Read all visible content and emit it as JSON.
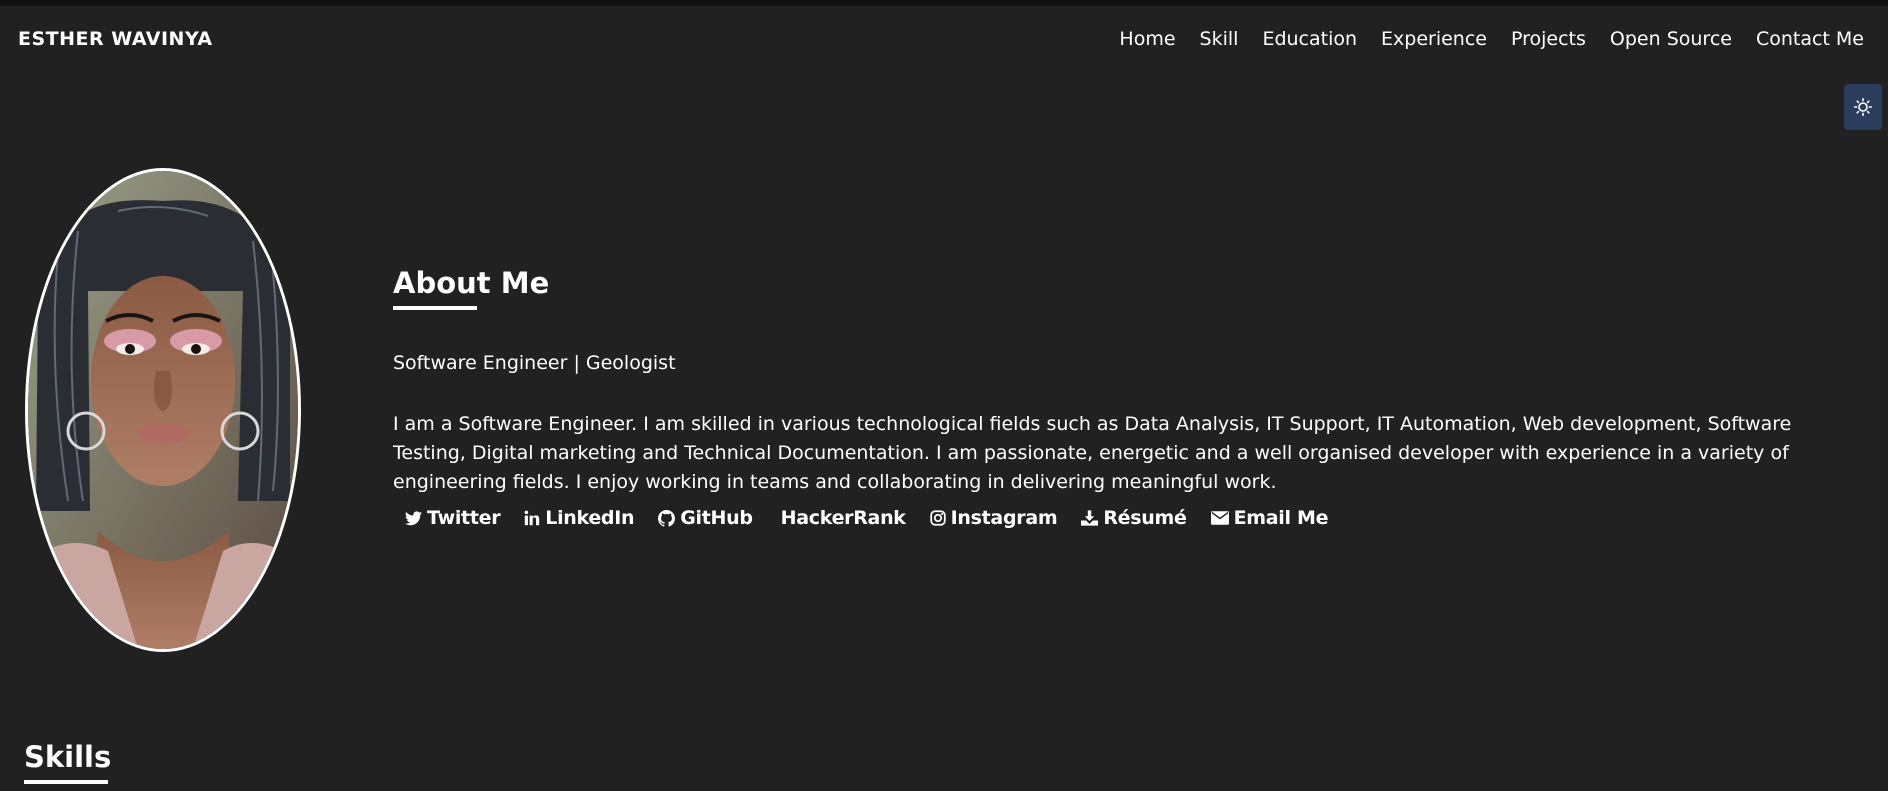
{
  "brand": "ESTHER WAVINYA",
  "nav": {
    "links": [
      "Home",
      "Skill",
      "Education",
      "Experience",
      "Projects",
      "Open Source",
      "Contact Me"
    ]
  },
  "theme_toggle": {
    "icon": "sun-icon"
  },
  "about": {
    "title": "About Me",
    "subtitle": "Software Engineer | Geologist",
    "description": "I am a Software Engineer. I am skilled in various technological fields such as Data Analysis, IT Support, IT Automation, Web development, Software Testing, Digital marketing and Technical Documentation. I am passionate, energetic and a well organised developer with experience in a variety of engineering fields. I enjoy working in teams and collaborating in delivering meaningful work.",
    "social": [
      {
        "label": "Twitter",
        "icon": "twitter-icon"
      },
      {
        "label": "LinkedIn",
        "icon": "linkedin-icon"
      },
      {
        "label": "GitHub",
        "icon": "github-icon"
      },
      {
        "label": "HackerRank",
        "icon": ""
      },
      {
        "label": "Instagram",
        "icon": "instagram-icon"
      },
      {
        "label": "Résumé",
        "icon": "download-icon"
      },
      {
        "label": "Email Me",
        "icon": "envelope-icon"
      }
    ]
  },
  "skills": {
    "title": "Skills"
  },
  "colors": {
    "background": "#212121",
    "text": "#ffffff",
    "theme_button": "#2b3d5c"
  }
}
